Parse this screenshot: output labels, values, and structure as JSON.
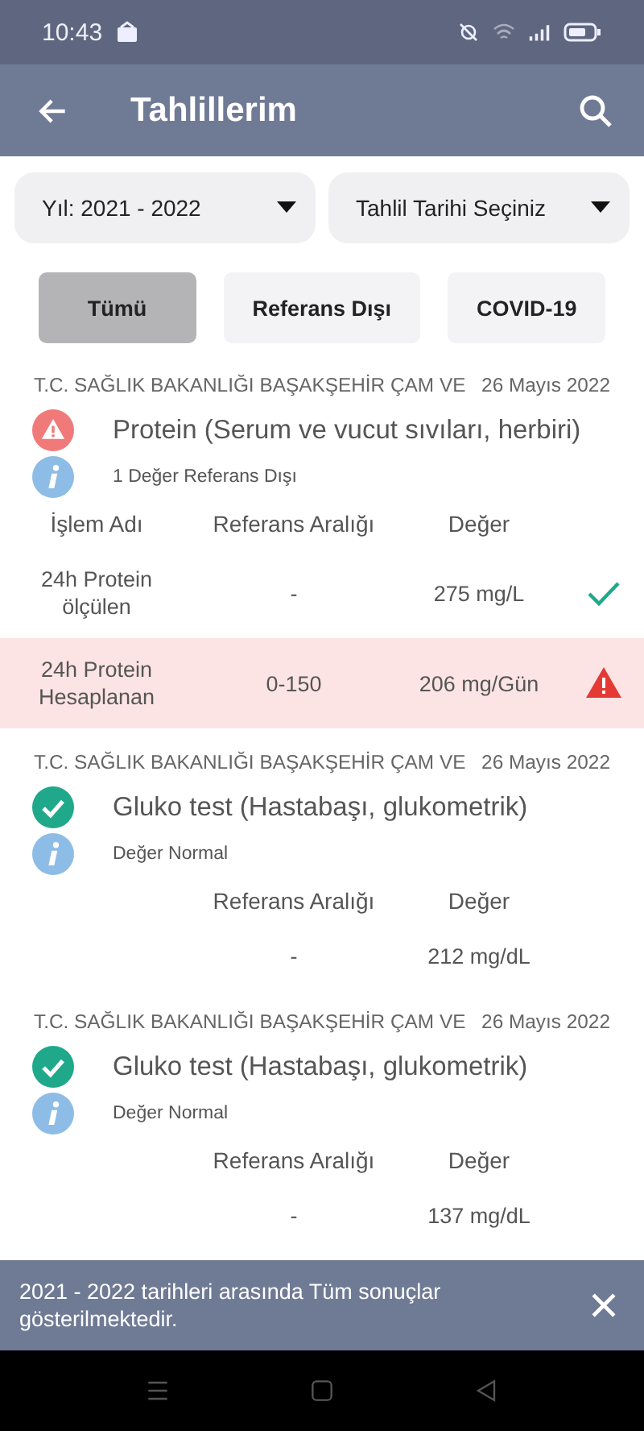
{
  "status_bar": {
    "time": "10:43"
  },
  "app_bar": {
    "title": "Tahlillerim"
  },
  "filters": [
    {
      "label": "Yıl: 2021 - 2022"
    },
    {
      "label": "Tahlil Tarihi Seçiniz"
    }
  ],
  "chips": [
    {
      "label": "Tümü",
      "selected": true
    },
    {
      "label": "Referans Dışı",
      "selected": false
    },
    {
      "label": "COVID-19",
      "selected": false
    }
  ],
  "results": [
    {
      "lab": "T.C. SAĞLIK BAKANLIĞI BAŞAKŞEHİR ÇAM VE",
      "date": "26 Mayıs 2022",
      "name": "Protein (Serum ve vucut sıvıları, herbiri)",
      "out_of_range": true,
      "note": "1 Değer Referans Dışı",
      "columns": {
        "name": "İşlem Adı",
        "range": "Referans Aralığı",
        "value": "Değer"
      },
      "rows": [
        {
          "name": "24h Protein ölçülen",
          "range": "-",
          "value": "275 mg/L",
          "out_of_range": false
        },
        {
          "name": "24h Protein Hesaplanan",
          "range": "0-150",
          "value": "206 mg/Gün",
          "out_of_range": true
        }
      ]
    },
    {
      "lab": "T.C. SAĞLIK BAKANLIĞI BAŞAKŞEHİR ÇAM VE",
      "date": "26 Mayıs 2022",
      "name": "Gluko test (Hastabaşı, glukometrik)",
      "out_of_range": false,
      "note": "Değer Normal",
      "columns": {
        "range": "Referans Aralığı",
        "value": "Değer"
      },
      "rows": [
        {
          "range": "-",
          "value": "212 mg/dL"
        }
      ]
    },
    {
      "lab": "T.C. SAĞLIK BAKANLIĞI BAŞAKŞEHİR ÇAM VE",
      "date": "26 Mayıs 2022",
      "name": "Gluko test (Hastabaşı, glukometrik)",
      "out_of_range": false,
      "note": "Değer Normal",
      "columns": {
        "range": "Referans Aralığı",
        "value": "Değer"
      },
      "rows": [
        {
          "range": "-",
          "value": "137 mg/dL"
        }
      ]
    }
  ],
  "snackbar": {
    "text": "2021 - 2022 tarihleri arasında Tüm sonuçlar gösterilmektedir."
  }
}
